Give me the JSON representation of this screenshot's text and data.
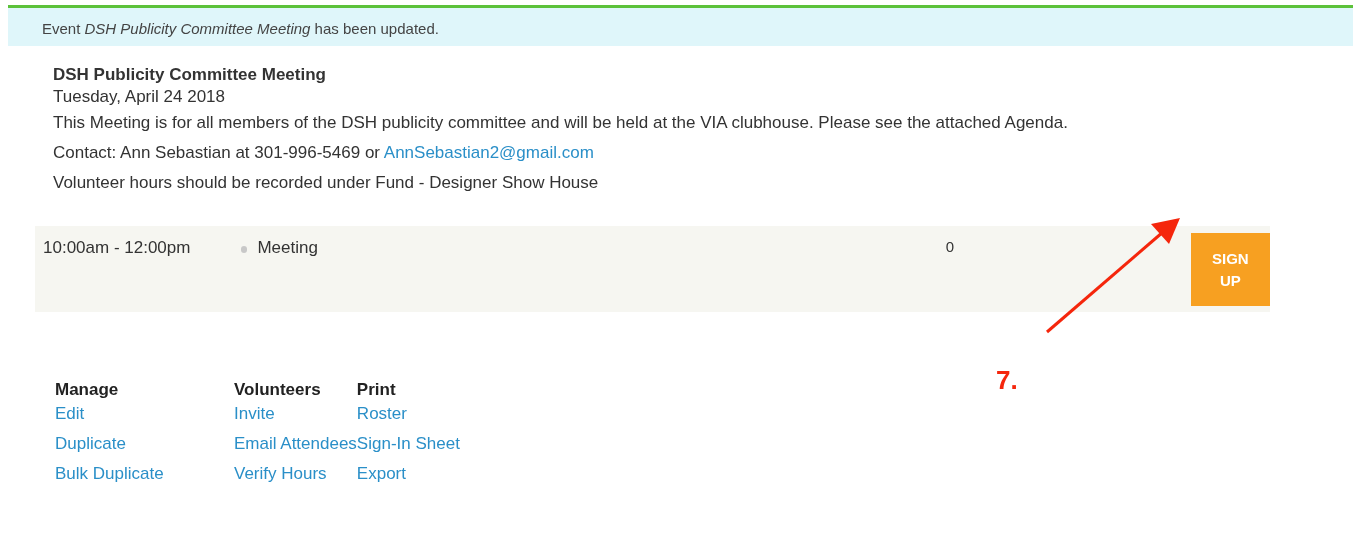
{
  "notice": {
    "text": "Event *DSH Publicity Committee Meeting* has been updated."
  },
  "event": {
    "title": "DSH Publicity Committee Meeting",
    "date": "Tuesday, April 24 2018",
    "description": "This Meeting is for all members of the DSH publicity committee and will be held at the VIA clubhouse. Please see the attached Agenda.",
    "contact": {
      "text": "Contact: Ann Sebastian at 301-996-5469 or ",
      "email": "AnnSebastian2@gmail.com"
    },
    "note": "Volunteer hours should be recorded under Fund - Designer Show House"
  },
  "slot": {
    "time": "10:00am - 12:00pm",
    "type": "Meeting",
    "count": "0",
    "button": "SIGN UP"
  },
  "annotation": {
    "label": "7."
  },
  "actions": [
    {
      "heading": "Manage",
      "links": [
        "Edit",
        "Duplicate",
        "Bulk Duplicate"
      ]
    },
    {
      "heading": "Volunteers",
      "links": [
        "Invite",
        "Email Attendees",
        "Verify Hours"
      ]
    },
    {
      "heading": "Print",
      "links": [
        "Roster",
        "Sign-In Sheet",
        "Export"
      ]
    }
  ]
}
